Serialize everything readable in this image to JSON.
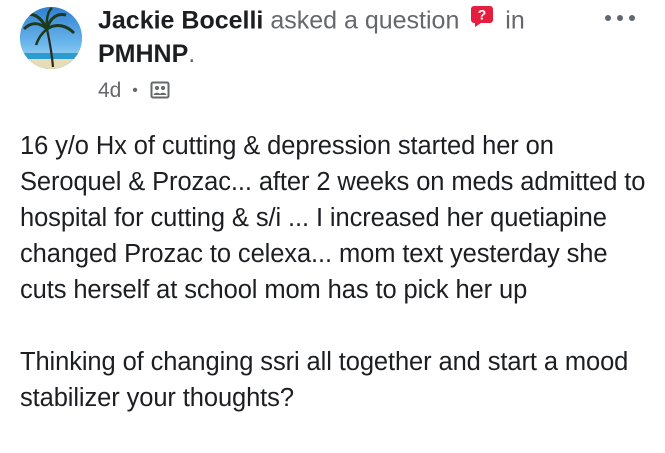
{
  "post": {
    "author": "Jackie Bocelli",
    "action": "asked a question",
    "in_word": "in",
    "group": "PMHNP",
    "group_suffix": ".",
    "time": "4d",
    "separator": "•",
    "privacy_icon": "group-members-icon",
    "question_icon": "question-badge-icon",
    "more_icon": "more-options-icon",
    "paragraphs": [
      "16 y/o Hx of cutting & depression started her on Seroquel & Prozac... after 2 weeks on meds admitted to hospital for cutting & s/i ... I increased her quetiapine changed Prozac to celexa... mom text yesterday she cuts herself at school mom has to pick her up",
      "Thinking of changing ssri all together and start a mood stabilizer your thoughts?"
    ]
  },
  "colors": {
    "text": "#1c1e21",
    "secondary": "#65676b",
    "question_badge": "#e41e3f"
  }
}
